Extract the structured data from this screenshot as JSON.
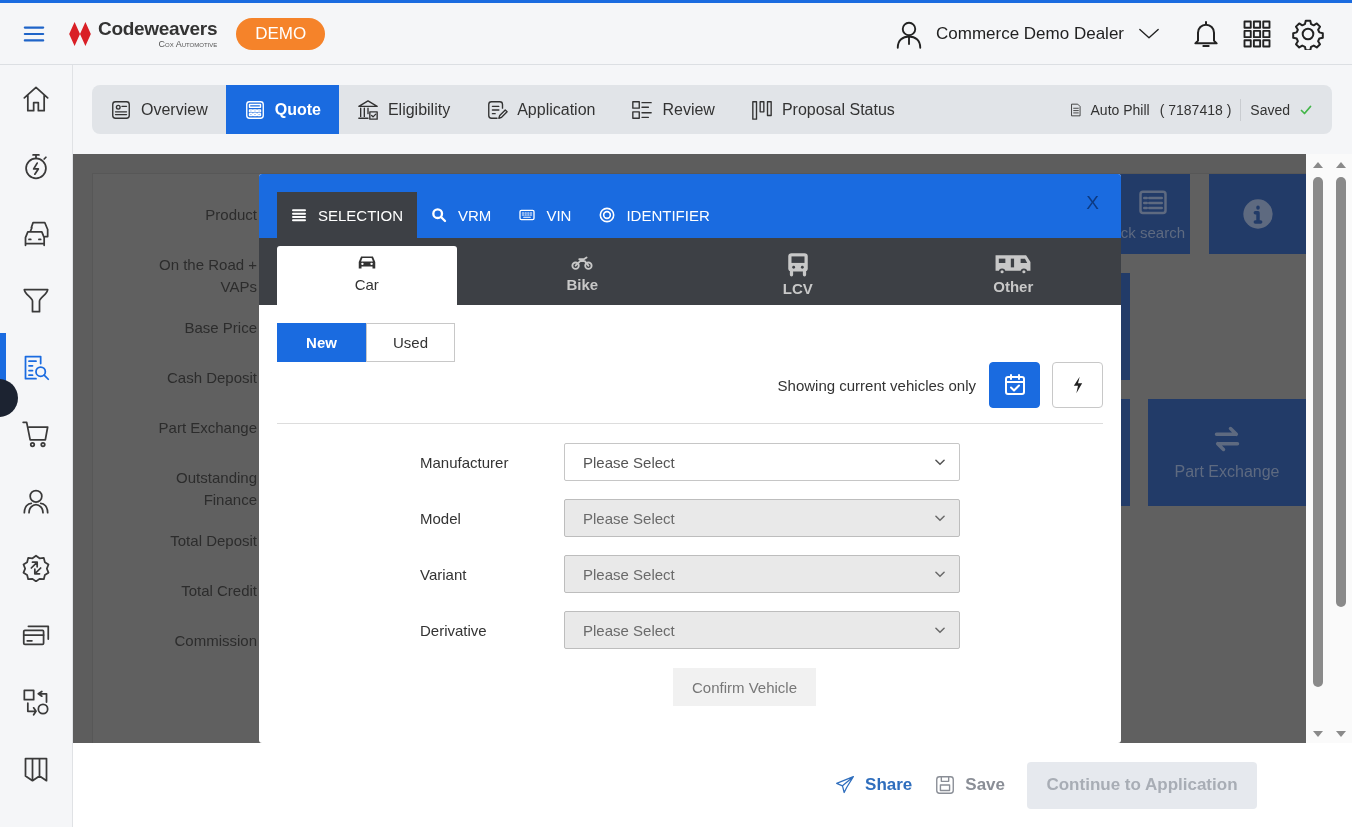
{
  "header": {
    "brand": "Codeweavers",
    "brand_sub": "Cox Automotive",
    "badge": "DEMO",
    "user": "Commerce Demo Dealer"
  },
  "sidebar": {
    "items": [
      {
        "selected": false
      },
      {
        "selected": false
      },
      {
        "selected": false
      },
      {
        "selected": false
      },
      {
        "selected": true
      },
      {
        "selected": false
      },
      {
        "selected": false
      },
      {
        "selected": false
      },
      {
        "selected": false
      },
      {
        "selected": false
      },
      {
        "selected": false
      }
    ]
  },
  "tabs": [
    {
      "label": "Overview",
      "selected": false
    },
    {
      "label": "Quote",
      "selected": true
    },
    {
      "label": "Eligibility",
      "selected": false
    },
    {
      "label": "Application",
      "selected": false
    },
    {
      "label": "Review",
      "selected": false
    },
    {
      "label": "Proposal Status",
      "selected": false
    }
  ],
  "record": {
    "name": "Auto Phill",
    "number": "( 7187418 )",
    "status": "Saved"
  },
  "background": {
    "labels": [
      "Product",
      "On the Road + VAPs",
      "Base Price",
      "Cash Deposit",
      "Part Exchange",
      "Outstanding Finance",
      "Total Deposit",
      "Total Credit",
      "Commission"
    ],
    "tiles": [
      {
        "kind": "search",
        "label": "ck search"
      },
      {
        "kind": "info"
      },
      {
        "kind": "edge"
      },
      {
        "kind": "edge"
      },
      {
        "kind": "exchange",
        "label": "Part Exchange"
      }
    ]
  },
  "modal": {
    "search_tabs": [
      {
        "label": "SELECTION",
        "selected": true
      },
      {
        "label": "VRM",
        "selected": false
      },
      {
        "label": "VIN",
        "selected": false
      },
      {
        "label": "IDENTIFIER",
        "selected": false
      }
    ],
    "close": "X",
    "vehicle_types": [
      {
        "label": "Car",
        "selected": true
      },
      {
        "label": "Bike",
        "selected": false
      },
      {
        "label": "LCV",
        "selected": false
      },
      {
        "label": "Other",
        "selected": false
      }
    ],
    "condition": [
      {
        "label": "New",
        "selected": true
      },
      {
        "label": "Used",
        "selected": false
      }
    ],
    "filter_note": "Showing current vehicles only",
    "filter_buttons": [
      {
        "kind": "calendar",
        "on": true
      },
      {
        "kind": "bolt",
        "on": false
      }
    ],
    "fields": [
      {
        "label": "Manufacturer",
        "value": "Please Select",
        "disabled": false
      },
      {
        "label": "Model",
        "value": "Please Select",
        "disabled": true
      },
      {
        "label": "Variant",
        "value": "Please Select",
        "disabled": true
      },
      {
        "label": "Derivative",
        "value": "Please Select",
        "disabled": true
      }
    ],
    "confirm": {
      "label": "Confirm Vehicle",
      "disabled": true
    }
  },
  "footer": {
    "share": "Share",
    "save": "Save",
    "continue": {
      "label": "Continue to Application",
      "disabled": true
    }
  }
}
